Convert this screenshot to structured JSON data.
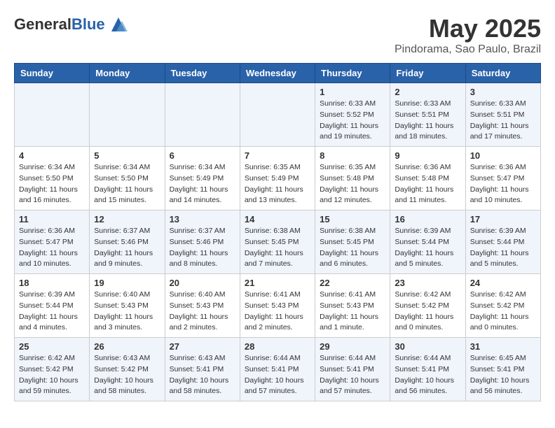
{
  "header": {
    "logo_general": "General",
    "logo_blue": "Blue",
    "month_title": "May 2025",
    "subtitle": "Pindorama, Sao Paulo, Brazil"
  },
  "days_of_week": [
    "Sunday",
    "Monday",
    "Tuesday",
    "Wednesday",
    "Thursday",
    "Friday",
    "Saturday"
  ],
  "weeks": [
    [
      {
        "day": "",
        "info": ""
      },
      {
        "day": "",
        "info": ""
      },
      {
        "day": "",
        "info": ""
      },
      {
        "day": "",
        "info": ""
      },
      {
        "day": "1",
        "info": "Sunrise: 6:33 AM\nSunset: 5:52 PM\nDaylight: 11 hours and 19 minutes."
      },
      {
        "day": "2",
        "info": "Sunrise: 6:33 AM\nSunset: 5:51 PM\nDaylight: 11 hours and 18 minutes."
      },
      {
        "day": "3",
        "info": "Sunrise: 6:33 AM\nSunset: 5:51 PM\nDaylight: 11 hours and 17 minutes."
      }
    ],
    [
      {
        "day": "4",
        "info": "Sunrise: 6:34 AM\nSunset: 5:50 PM\nDaylight: 11 hours and 16 minutes."
      },
      {
        "day": "5",
        "info": "Sunrise: 6:34 AM\nSunset: 5:50 PM\nDaylight: 11 hours and 15 minutes."
      },
      {
        "day": "6",
        "info": "Sunrise: 6:34 AM\nSunset: 5:49 PM\nDaylight: 11 hours and 14 minutes."
      },
      {
        "day": "7",
        "info": "Sunrise: 6:35 AM\nSunset: 5:49 PM\nDaylight: 11 hours and 13 minutes."
      },
      {
        "day": "8",
        "info": "Sunrise: 6:35 AM\nSunset: 5:48 PM\nDaylight: 11 hours and 12 minutes."
      },
      {
        "day": "9",
        "info": "Sunrise: 6:36 AM\nSunset: 5:48 PM\nDaylight: 11 hours and 11 minutes."
      },
      {
        "day": "10",
        "info": "Sunrise: 6:36 AM\nSunset: 5:47 PM\nDaylight: 11 hours and 10 minutes."
      }
    ],
    [
      {
        "day": "11",
        "info": "Sunrise: 6:36 AM\nSunset: 5:47 PM\nDaylight: 11 hours and 10 minutes."
      },
      {
        "day": "12",
        "info": "Sunrise: 6:37 AM\nSunset: 5:46 PM\nDaylight: 11 hours and 9 minutes."
      },
      {
        "day": "13",
        "info": "Sunrise: 6:37 AM\nSunset: 5:46 PM\nDaylight: 11 hours and 8 minutes."
      },
      {
        "day": "14",
        "info": "Sunrise: 6:38 AM\nSunset: 5:45 PM\nDaylight: 11 hours and 7 minutes."
      },
      {
        "day": "15",
        "info": "Sunrise: 6:38 AM\nSunset: 5:45 PM\nDaylight: 11 hours and 6 minutes."
      },
      {
        "day": "16",
        "info": "Sunrise: 6:39 AM\nSunset: 5:44 PM\nDaylight: 11 hours and 5 minutes."
      },
      {
        "day": "17",
        "info": "Sunrise: 6:39 AM\nSunset: 5:44 PM\nDaylight: 11 hours and 5 minutes."
      }
    ],
    [
      {
        "day": "18",
        "info": "Sunrise: 6:39 AM\nSunset: 5:44 PM\nDaylight: 11 hours and 4 minutes."
      },
      {
        "day": "19",
        "info": "Sunrise: 6:40 AM\nSunset: 5:43 PM\nDaylight: 11 hours and 3 minutes."
      },
      {
        "day": "20",
        "info": "Sunrise: 6:40 AM\nSunset: 5:43 PM\nDaylight: 11 hours and 2 minutes."
      },
      {
        "day": "21",
        "info": "Sunrise: 6:41 AM\nSunset: 5:43 PM\nDaylight: 11 hours and 2 minutes."
      },
      {
        "day": "22",
        "info": "Sunrise: 6:41 AM\nSunset: 5:43 PM\nDaylight: 11 hours and 1 minute."
      },
      {
        "day": "23",
        "info": "Sunrise: 6:42 AM\nSunset: 5:42 PM\nDaylight: 11 hours and 0 minutes."
      },
      {
        "day": "24",
        "info": "Sunrise: 6:42 AM\nSunset: 5:42 PM\nDaylight: 11 hours and 0 minutes."
      }
    ],
    [
      {
        "day": "25",
        "info": "Sunrise: 6:42 AM\nSunset: 5:42 PM\nDaylight: 10 hours and 59 minutes."
      },
      {
        "day": "26",
        "info": "Sunrise: 6:43 AM\nSunset: 5:42 PM\nDaylight: 10 hours and 58 minutes."
      },
      {
        "day": "27",
        "info": "Sunrise: 6:43 AM\nSunset: 5:41 PM\nDaylight: 10 hours and 58 minutes."
      },
      {
        "day": "28",
        "info": "Sunrise: 6:44 AM\nSunset: 5:41 PM\nDaylight: 10 hours and 57 minutes."
      },
      {
        "day": "29",
        "info": "Sunrise: 6:44 AM\nSunset: 5:41 PM\nDaylight: 10 hours and 57 minutes."
      },
      {
        "day": "30",
        "info": "Sunrise: 6:44 AM\nSunset: 5:41 PM\nDaylight: 10 hours and 56 minutes."
      },
      {
        "day": "31",
        "info": "Sunrise: 6:45 AM\nSunset: 5:41 PM\nDaylight: 10 hours and 56 minutes."
      }
    ]
  ]
}
